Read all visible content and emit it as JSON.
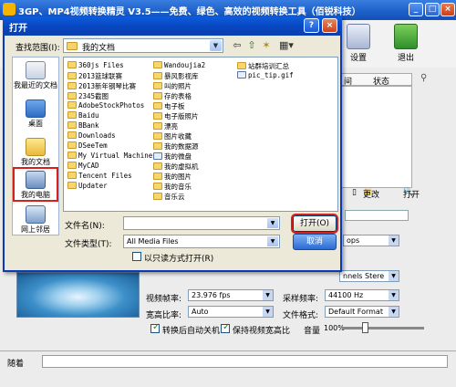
{
  "app": {
    "title": "3GP、MP4视频转换精灵 V3.5——免费、绿色、高效的视频转换工具（佰锐科技）",
    "toolbar": {
      "settings_label": "设置",
      "exit_label": "退出"
    },
    "list_headers": {
      "col1": "间",
      "col2": "状态"
    },
    "actions": {
      "change_label": "更改",
      "open_label": "打开"
    },
    "settings": {
      "bitrate_label": "ops",
      "channels_value": "nnels Stere",
      "framerate_label": "视频帧率:",
      "framerate_value": "23.976 fps",
      "samplerate_label": "采样频率:",
      "samplerate_value": "44100 Hz",
      "aspect_label": "宽高比率:",
      "aspect_value": "Auto",
      "format_label": "文件格式:",
      "format_value": "Default Format",
      "shutdown_label": "转换后自动关机",
      "keep_ratio_label": "保持视频宽高比",
      "volume_label": "音量",
      "volume_value": "100%"
    },
    "status": {
      "left_label": "随着"
    }
  },
  "dialog": {
    "title": "打开",
    "lookin_label": "查找范围(I):",
    "lookin_value": "我的文档",
    "places": [
      {
        "label": "我最近的文档"
      },
      {
        "label": "桌面"
      },
      {
        "label": "我的文档"
      },
      {
        "label": "我的电脑"
      },
      {
        "label": "网上邻居"
      }
    ],
    "files": [
      "360js Files",
      "2013篮球联赛",
      "2013新年钢琴比赛",
      "2345截图",
      "AdobeStockPhotos",
      "Baidu",
      "BBank",
      "Downloads",
      "DSeeTem",
      "My Virtual Machines",
      "MyCAD",
      "Tencent Files",
      "Updater",
      "Wandoujia2",
      "暴风影视库",
      "叫的照片",
      "存的表格",
      "电子板",
      "电子版照片",
      "漂亮",
      "图片收藏",
      "我的数据源",
      "我的微盘",
      "我的虚拟机",
      "我的图片",
      "我的音乐",
      "音乐云",
      "站群培训汇总",
      "pic_tip.gif"
    ],
    "filename_label": "文件名(N):",
    "filename_value": "",
    "filetype_label": "文件类型(T):",
    "filetype_value": "All Media Files",
    "readonly_label": "以只读方式打开(R)",
    "open_button": "打开(O)",
    "cancel_button": "取消"
  },
  "colors": {
    "titlebar": "#1c5fc8",
    "highlight": "#d8201a",
    "dialog_bg": "#ece9d8"
  }
}
